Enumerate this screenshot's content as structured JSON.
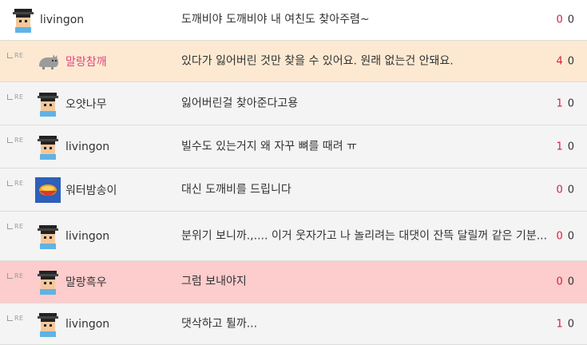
{
  "comments": [
    {
      "nick": "livingon",
      "avatar": "villager-avatar-icon",
      "text": "도깨비야 도깨비야 내 여친도 찾아주렴~",
      "up": "0",
      "down": "0"
    },
    {
      "nick": "말랑참깨",
      "avatar": "cat-avatar-icon",
      "text": "있다가 잃어버린 것만 찾을 수 있어요. 원래 없는건 안돼요.",
      "up": "4",
      "down": "0"
    },
    {
      "nick": "오얏나무",
      "avatar": "villager-avatar-icon",
      "text": "잃어버린걸 찾아준다고용",
      "up": "1",
      "down": "0"
    },
    {
      "nick": "livingon",
      "avatar": "villager-avatar-icon",
      "text": "빌수도 있는거지 왜 자꾸 뼈를 때려 ㅠ",
      "up": "1",
      "down": "0"
    },
    {
      "nick": "워터밤송이",
      "avatar": "bowl-avatar-icon",
      "text": "대신 도깨비를 드립니다",
      "up": "0",
      "down": "0"
    },
    {
      "nick": "livingon",
      "avatar": "villager-avatar-icon",
      "text": "분위기 보니까.,.... 이거 웃자가고 나 놀리려는 대댓이 잔뜩 달릴꺼 같은 기분...",
      "up": "0",
      "down": "0"
    },
    {
      "nick": "말랑흑우",
      "avatar": "villager-avatar-icon",
      "text": "그럼 보내야지",
      "up": "0",
      "down": "0"
    },
    {
      "nick": "livingon",
      "avatar": "villager-avatar-icon",
      "text": "댓삭하고 튈까...",
      "up": "1",
      "down": "0"
    }
  ],
  "reply_marker": "RE",
  "colors": {
    "upvote": "#d81e3d",
    "pink_nick": "#e0447e",
    "highlight_orange": "#fde9d2",
    "highlight_red": "#fdcccc"
  }
}
